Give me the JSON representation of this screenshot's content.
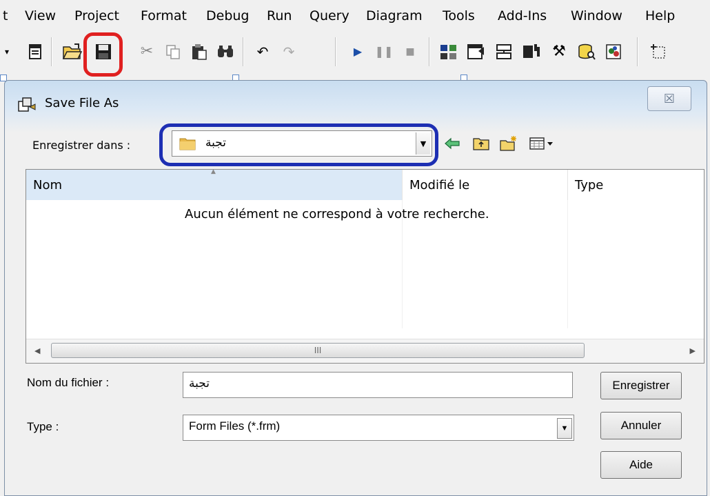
{
  "menubar": {
    "items": [
      "t",
      "View",
      "Project",
      "Format",
      "Debug",
      "Run",
      "Query",
      "Diagram",
      "Tools",
      "Add-Ins",
      "Window",
      "Help"
    ]
  },
  "toolbar": {
    "buttons": [
      "dropdown-arrow-icon",
      "form-icon",
      "open-folder-icon",
      "save-disk-icon",
      "cut-icon",
      "copy-icon",
      "paste-icon",
      "find-icon",
      "undo-icon",
      "redo-icon",
      "run-icon",
      "pause-icon",
      "stop-icon",
      "project-explorer-icon",
      "properties-icon",
      "form-layout-icon",
      "object-browser-icon",
      "toolbox-icon",
      "data-view-icon",
      "visual-component-icon",
      "toolbar-end-icon"
    ]
  },
  "dialog": {
    "title": "Save File As",
    "close_glyph": "☒",
    "save_in_label": "Enregistrer dans :",
    "save_in_value": "تجبة",
    "columns": [
      "Nom",
      "Modifié le",
      "Type"
    ],
    "empty_message": "Aucun élément ne correspond à votre recherche.",
    "scroll_grip": "III",
    "filename_label": "Nom du fichier :",
    "filename_value": "تجبة",
    "type_label": "Type :",
    "type_value": "Form Files (*.frm)",
    "buttons": {
      "save": "Enregistrer",
      "cancel": "Annuler",
      "help": "Aide"
    }
  },
  "colors": {
    "highlight_save_button": "#e02020",
    "highlight_location_combo": "#1d2fb3",
    "folder": "#e8b84a",
    "header_selected": "#dbe9f7"
  }
}
